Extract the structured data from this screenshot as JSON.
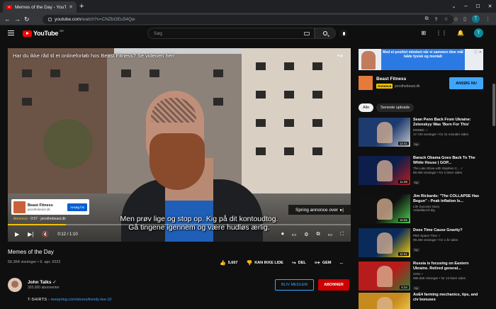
{
  "browser": {
    "tab_title": "Memes of the Day - YouTube",
    "url_host": "youtube.com",
    "url_path": "/watch?v=CNZbOEu54Qw",
    "window_controls": [
      "⌄",
      "─",
      "☐",
      "✕"
    ],
    "profile_letter": "T"
  },
  "youtube": {
    "logo_text": "YouTube",
    "logo_country": "DK",
    "search_placeholder": "Søg",
    "avatar_letter": "T"
  },
  "player": {
    "ad_title": "Har du ikke råd til et onlineforløb hos Beast Fitness? Se videoen her!",
    "ad_card_name": "Beast Fitness",
    "ad_card_domain": "jenothebeast.dk",
    "ad_card_button": "Ansøg his",
    "ad_label": "Annonce",
    "ad_time": "0:57",
    "ad_domain": "jenothebeast.dk",
    "skip_text": "Spring annonce over",
    "subtitle_line1": "Men prøv lige og stop op. Kig på dit kontoudtog.",
    "subtitle_line2": "Gå tingene igennem og være hudløs ærlig.",
    "time_display": "0:12 / 1:10",
    "progress_fraction": 0.17,
    "accent_color": "#f2c200"
  },
  "video": {
    "title": "Memes of the Day",
    "views": "50.364 visninger",
    "date": "6. apr. 2022",
    "likes": "5.667",
    "dislike_label": "KAN IKKE LIDE",
    "share_label": "DEL",
    "save_label": "GEM",
    "more_label": "..."
  },
  "channel": {
    "name": "John Talks",
    "subscribers": "303.000 abonnenter",
    "member_label": "BLIV MEDLEM",
    "subscribe_label": "ABONNER"
  },
  "description": {
    "prefix": "T-SHIRTS - ",
    "link": "teespring.com/stores/trendy-tee-10"
  },
  "sidebar_ad": {
    "banner_text": "Med et positivt mindset når vi sammen dine mål både fysisk og mentalt",
    "close_label": "ⓘ ✕",
    "advertiser": "Beast Fitness",
    "badge": "Annonce",
    "domain": "jenothebeast.dk",
    "button_label": "ANSØG NU"
  },
  "chips": [
    "Alle",
    "Seneste uploads"
  ],
  "recommendations": [
    {
      "title": "Sean Penn Back From Ukraine: Zelenskyy Was 'Born For This'",
      "channel": "MSNBC ✓",
      "views": "17.740 visninger • for 41 minutter siden",
      "badge": "Ny",
      "duration": "12:41",
      "color": "#1d3b6e",
      "accent": "#c8c8d0"
    },
    {
      "title": "Barack Obama Goes Back To The White House | GOP...",
      "channel": "The Late Show with Stephen C... ✓",
      "views": "89.306 visninger • for 2 timer siden",
      "badge": "Ny",
      "duration": "11:58",
      "color": "#0d1e4c",
      "accent": "#c01a1a"
    },
    {
      "title": "Jim Rickards: \"The COLLAPSE Has Begun\" - Peak inflation Is...",
      "channel": "Life Success Story",
      "views": "Anbefalet til dig",
      "badge": "",
      "duration": "16:56",
      "color": "#101010",
      "accent": "#4cd04c"
    },
    {
      "title": "Does Time Cause Gravity?",
      "channel": "PBS Space Time ✓",
      "views": "99.406 visninger • for 1 år siden",
      "badge": "Ny",
      "duration": "11:51",
      "color": "#0a2a5a",
      "accent": "#ffd400"
    },
    {
      "title": "Russia is focusing on Eastern Ukraine. Retired general...",
      "channel": "CNN ✓",
      "views": "695.666 visninger • for 13 timer siden",
      "badge": "Ny",
      "duration": "5:34",
      "color": "#b71c1c",
      "accent": "#2e7d32"
    },
    {
      "title": "AoE4 farming mechanics, tips, and civ bonuses",
      "channel": "",
      "views": "",
      "badge": "",
      "duration": "",
      "color": "#c68a1f",
      "accent": "#ffdf5a"
    }
  ]
}
